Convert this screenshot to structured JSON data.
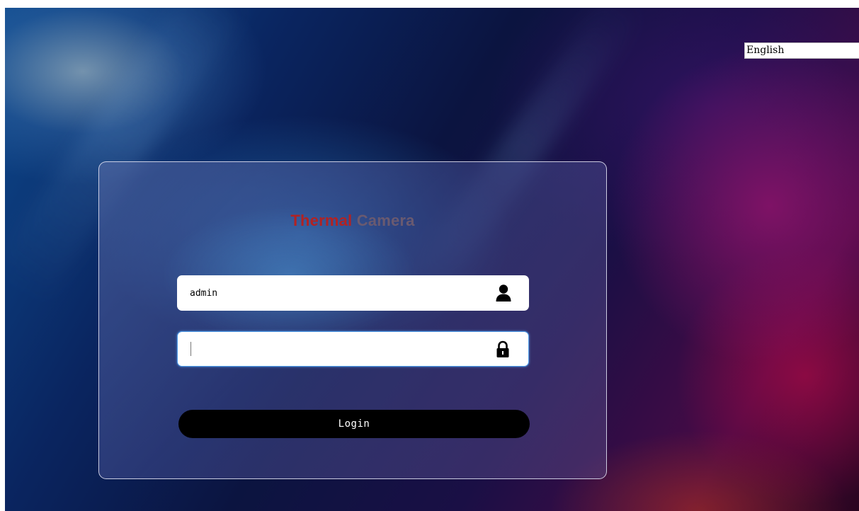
{
  "language": {
    "selected": "English"
  },
  "login": {
    "title_part1": "Thermal",
    "title_part2": "Camera",
    "username_value": "admin",
    "password_value": "",
    "login_label": "Login",
    "username_icon": "user-icon",
    "password_icon": "lock-icon"
  },
  "colors": {
    "title_part1": "#b22222",
    "title_part2": "#6a5a70",
    "login_button": "#000000",
    "focus_border": "#4f9be8"
  }
}
